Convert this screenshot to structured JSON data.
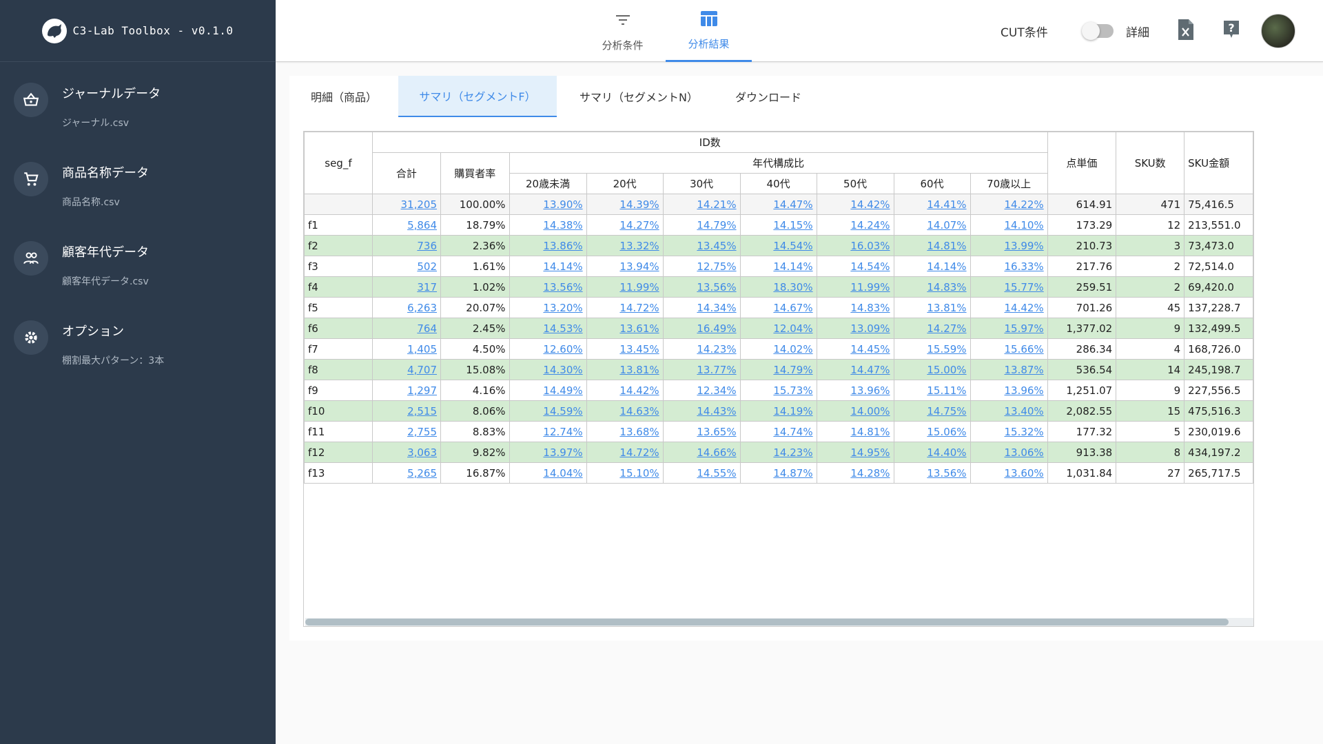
{
  "app": {
    "title": "C3-Lab Toolbox - v0.1.0"
  },
  "sidebar": {
    "items": [
      {
        "title": "ジャーナルデータ",
        "sub": "ジャーナル.csv",
        "icon": "basket-icon"
      },
      {
        "title": "商品名称データ",
        "sub": "商品名称.csv",
        "icon": "cart-icon"
      },
      {
        "title": "顧客年代データ",
        "sub": "顧客年代データ.csv",
        "icon": "people-icon"
      },
      {
        "title": "オプション",
        "sub": "棚割最大パターン：3本",
        "icon": "gear-icon"
      }
    ]
  },
  "topbar": {
    "tabs": [
      {
        "label": "分析条件",
        "icon": "filter-icon"
      },
      {
        "label": "分析結果",
        "icon": "table-icon",
        "active": true
      }
    ],
    "cut_label": "CUT条件",
    "toggle_label": "詳細",
    "toggle_on": false
  },
  "subtabs": [
    {
      "label": "明細（商品）"
    },
    {
      "label": "サマリ（セグメントF）",
      "active": true
    },
    {
      "label": "サマリ（セグメントN）"
    },
    {
      "label": "ダウンロード"
    }
  ],
  "table": {
    "headers": {
      "seg": "seg_f",
      "id_count": "ID数",
      "total": "合計",
      "buy_rate": "購買者率",
      "age_ratio": "年代構成比",
      "ages": [
        "20歳未満",
        "20代",
        "30代",
        "40代",
        "50代",
        "60代",
        "70歳以上"
      ],
      "unit_price": "点単価",
      "sku_count": "SKU数",
      "sku_amount": "SKU金額"
    },
    "rows": [
      {
        "seg": "",
        "total": "31,205",
        "rate": "100.00%",
        "ages": [
          "13.90%",
          "14.39%",
          "14.21%",
          "14.47%",
          "14.42%",
          "14.41%",
          "14.22%"
        ],
        "price": "614.91",
        "sku": "471",
        "amt": "75,416.5",
        "kind": "total"
      },
      {
        "seg": "f1",
        "total": "5,864",
        "rate": "18.79%",
        "ages": [
          "14.38%",
          "14.27%",
          "14.79%",
          "14.15%",
          "14.24%",
          "14.07%",
          "14.10%"
        ],
        "price": "173.29",
        "sku": "12",
        "amt": "213,551.0",
        "kind": "plain"
      },
      {
        "seg": "f2",
        "total": "736",
        "rate": "2.36%",
        "ages": [
          "13.86%",
          "13.32%",
          "13.45%",
          "14.54%",
          "16.03%",
          "14.81%",
          "13.99%"
        ],
        "price": "210.73",
        "sku": "3",
        "amt": "73,473.0",
        "kind": "hl"
      },
      {
        "seg": "f3",
        "total": "502",
        "rate": "1.61%",
        "ages": [
          "14.14%",
          "13.94%",
          "12.75%",
          "14.14%",
          "14.54%",
          "14.14%",
          "16.33%"
        ],
        "price": "217.76",
        "sku": "2",
        "amt": "72,514.0",
        "kind": "plain"
      },
      {
        "seg": "f4",
        "total": "317",
        "rate": "1.02%",
        "ages": [
          "13.56%",
          "11.99%",
          "13.56%",
          "18.30%",
          "11.99%",
          "14.83%",
          "15.77%"
        ],
        "price": "259.51",
        "sku": "2",
        "amt": "69,420.0",
        "kind": "hl"
      },
      {
        "seg": "f5",
        "total": "6,263",
        "rate": "20.07%",
        "ages": [
          "13.20%",
          "14.72%",
          "14.34%",
          "14.67%",
          "14.83%",
          "13.81%",
          "14.42%"
        ],
        "price": "701.26",
        "sku": "45",
        "amt": "137,228.7",
        "kind": "plain"
      },
      {
        "seg": "f6",
        "total": "764",
        "rate": "2.45%",
        "ages": [
          "14.53%",
          "13.61%",
          "16.49%",
          "12.04%",
          "13.09%",
          "14.27%",
          "15.97%"
        ],
        "price": "1,377.02",
        "sku": "9",
        "amt": "132,499.5",
        "kind": "hl"
      },
      {
        "seg": "f7",
        "total": "1,405",
        "rate": "4.50%",
        "ages": [
          "12.60%",
          "13.45%",
          "14.23%",
          "14.02%",
          "14.45%",
          "15.59%",
          "15.66%"
        ],
        "price": "286.34",
        "sku": "4",
        "amt": "168,726.0",
        "kind": "plain"
      },
      {
        "seg": "f8",
        "total": "4,707",
        "rate": "15.08%",
        "ages": [
          "14.30%",
          "13.81%",
          "13.77%",
          "14.79%",
          "14.47%",
          "15.00%",
          "13.87%"
        ],
        "price": "536.54",
        "sku": "14",
        "amt": "245,198.7",
        "kind": "hl"
      },
      {
        "seg": "f9",
        "total": "1,297",
        "rate": "4.16%",
        "ages": [
          "14.49%",
          "14.42%",
          "12.34%",
          "15.73%",
          "13.96%",
          "15.11%",
          "13.96%"
        ],
        "price": "1,251.07",
        "sku": "9",
        "amt": "227,556.5",
        "kind": "plain"
      },
      {
        "seg": "f10",
        "total": "2,515",
        "rate": "8.06%",
        "ages": [
          "14.59%",
          "14.63%",
          "14.43%",
          "14.19%",
          "14.00%",
          "14.75%",
          "13.40%"
        ],
        "price": "2,082.55",
        "sku": "15",
        "amt": "475,516.3",
        "kind": "hl"
      },
      {
        "seg": "f11",
        "total": "2,755",
        "rate": "8.83%",
        "ages": [
          "12.74%",
          "13.68%",
          "13.65%",
          "14.74%",
          "14.81%",
          "15.06%",
          "15.32%"
        ],
        "price": "177.32",
        "sku": "5",
        "amt": "230,019.6",
        "kind": "plain"
      },
      {
        "seg": "f12",
        "total": "3,063",
        "rate": "9.82%",
        "ages": [
          "13.97%",
          "14.72%",
          "14.66%",
          "14.23%",
          "14.95%",
          "14.40%",
          "13.06%"
        ],
        "price": "913.38",
        "sku": "8",
        "amt": "434,197.2",
        "kind": "hl"
      },
      {
        "seg": "f13",
        "total": "5,265",
        "rate": "16.87%",
        "ages": [
          "14.04%",
          "15.10%",
          "14.55%",
          "14.87%",
          "14.28%",
          "13.56%",
          "13.60%"
        ],
        "price": "1,031.84",
        "sku": "27",
        "amt": "265,717.5",
        "kind": "plain"
      }
    ]
  },
  "colors": {
    "sidebar_bg": "#2c3a4b",
    "accent": "#3f8ae8",
    "row_highlight": "#d4ecd2"
  }
}
